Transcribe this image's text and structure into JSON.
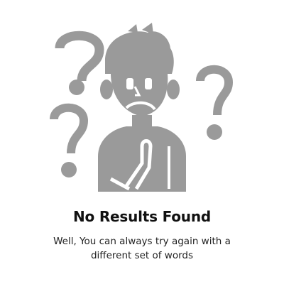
{
  "empty_state": {
    "title": "No Results Found",
    "message": "Well, You can always try again with a different set of words",
    "illustration_icon": "confused-person-icon",
    "illustration_color": "#9a9a9a"
  }
}
